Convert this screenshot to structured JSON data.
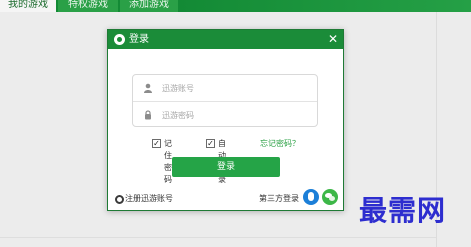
{
  "app": {
    "tabs": [
      {
        "label": "我的游戏"
      },
      {
        "label": "特权游戏"
      },
      {
        "label": "添加游戏"
      }
    ],
    "colors": {
      "header": "#138a35"
    }
  },
  "dialog": {
    "title": "登录",
    "close_icon": "close-icon",
    "fields": {
      "account_placeholder": "迅游账号",
      "password_placeholder": "迅游密码"
    },
    "options": {
      "remember_password": {
        "label": "记住密码",
        "checked": true
      },
      "auto_login": {
        "label": "自动登录",
        "checked": true
      },
      "forgot_password": "忘记密码？"
    },
    "login_button": "登录",
    "register_link": "注册迅游账号",
    "third_party_label": "第三方登录",
    "social": [
      "qq-icon",
      "wechat-icon"
    ],
    "colors": {
      "accent": "#25a447",
      "link": "#29a043"
    }
  },
  "watermark": "最需网"
}
